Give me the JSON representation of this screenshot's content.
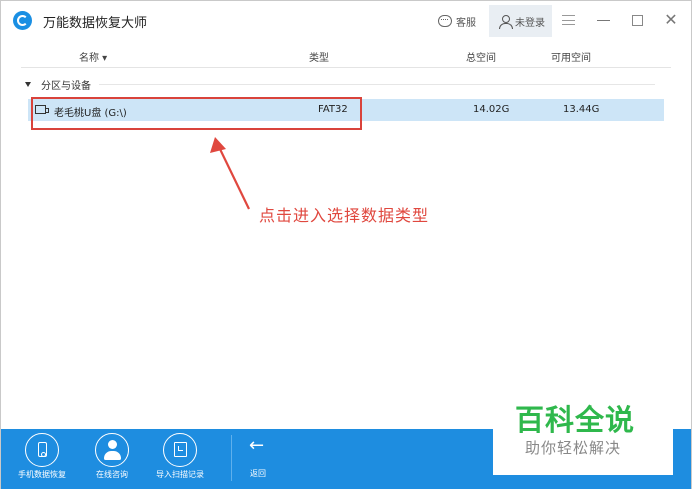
{
  "app": {
    "title": "万能数据恢复大师"
  },
  "titlebar": {
    "service_label": "客服",
    "user_label": "未登录",
    "close_glyph": "✕"
  },
  "table": {
    "columns": [
      "名称 ▾",
      "类型",
      "总空间",
      "可用空间"
    ],
    "group_label": "分区与设备",
    "rows": [
      {
        "name": "老毛桃U盘 (G:\\)",
        "type": "FAT32",
        "total": "14.02G",
        "free": "13.44G"
      }
    ]
  },
  "annotation": {
    "text": "点击进入选择数据类型",
    "color": "#e0483f"
  },
  "footer": {
    "items": [
      {
        "label": "手机数据恢复",
        "icon": "phone-icon"
      },
      {
        "label": "在线咨询",
        "icon": "person-icon"
      },
      {
        "label": "导入扫描记录",
        "icon": "import-icon"
      }
    ],
    "back_label": "返回",
    "back_glyph": "←"
  },
  "watermark": {
    "line1": "百科全说",
    "line2": "助你轻松解决"
  },
  "colors": {
    "accent": "#1e8de0",
    "selected_row": "#cde5f7",
    "highlight": "#d9433b",
    "watermark_green": "#2fb84c"
  }
}
